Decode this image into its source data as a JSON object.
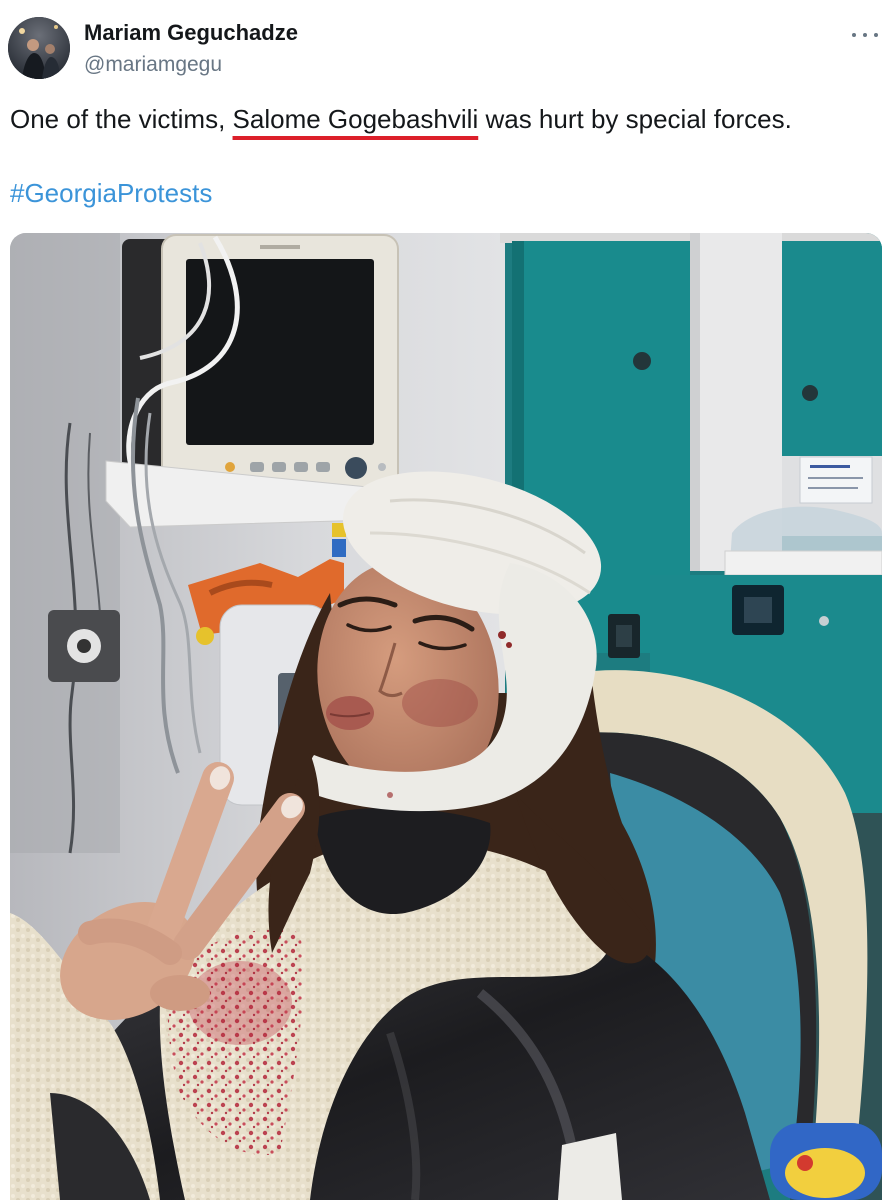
{
  "author": {
    "name": "Mariam Geguchadze",
    "handle": "@mariamgegu"
  },
  "icons": {
    "more": "more-horizontal-icon"
  },
  "tweet": {
    "text_before": "One of the victims, ",
    "text_highlight": "Salome Gogebashvili",
    "text_after": " was hurt by special forces.",
    "hashtag": "#GeorgiaProtests"
  },
  "colors": {
    "text": "#14171a",
    "secondary_text": "#687684",
    "hashtag_link": "#3b94d9",
    "highlight_underline": "#dc1f2a",
    "background": "#ffffff"
  }
}
